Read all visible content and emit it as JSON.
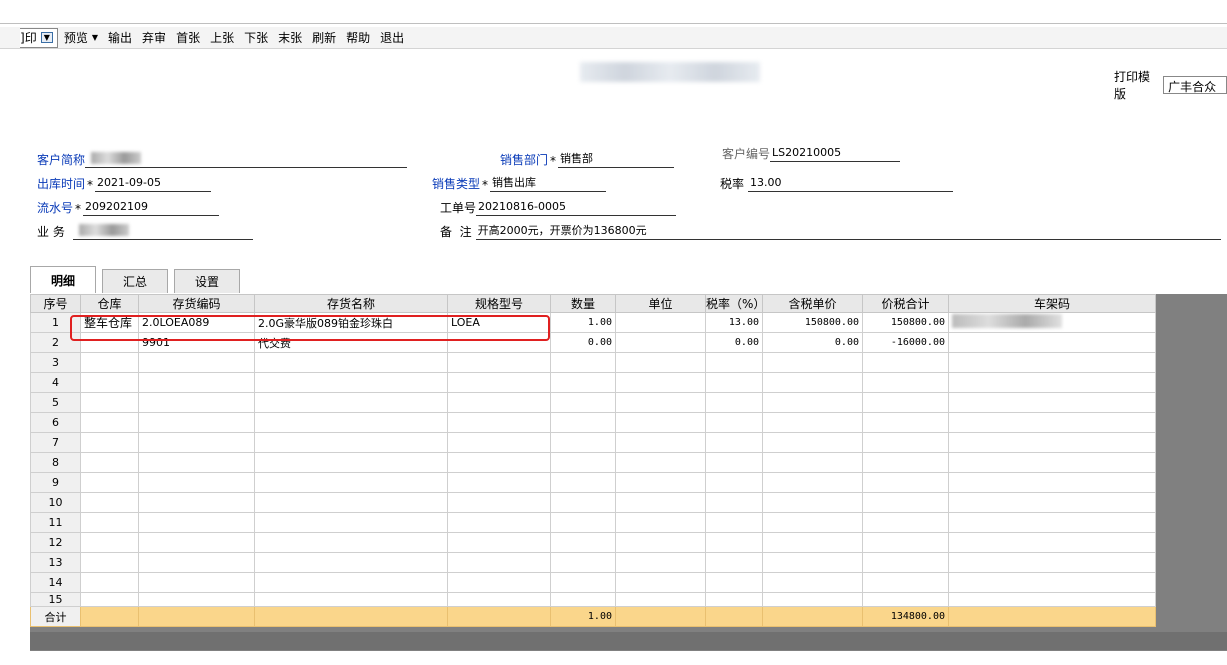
{
  "toolbar": {
    "print": "印",
    "print_prefix": "]",
    "preview": "预览",
    "export": "输出",
    "unapprove": "弃审",
    "first": "首张",
    "prev": "上张",
    "next": "下张",
    "last": "末张",
    "refresh": "刷新",
    "help": "帮助",
    "exit": "退出"
  },
  "print_template": {
    "label": "打印模版",
    "value": "广丰合众"
  },
  "form": {
    "customer_name": {
      "label": "客户简称",
      "value": ""
    },
    "dept": {
      "label": "销售部门",
      "value": "销售部"
    },
    "customer_code": {
      "label": "客户编号",
      "value": "LS20210005"
    },
    "out_date": {
      "label": "出库时间",
      "value": "2021-09-05"
    },
    "sale_type": {
      "label": "销售类型",
      "value": "销售出库"
    },
    "tax_rate": {
      "label": "税率",
      "value": "13.00"
    },
    "serial": {
      "label": "流水号",
      "value": "209202109"
    },
    "work_order": {
      "label": "工单号",
      "value": "20210816-0005"
    },
    "business": {
      "label": "业 务",
      "value": ""
    },
    "remark": {
      "label": "备  注",
      "value": "开高2000元，开票价为136800元"
    }
  },
  "tabs": [
    "明细",
    "汇总",
    "设置"
  ],
  "grid": {
    "headers": [
      "序号",
      "仓库",
      "存货编码",
      "存货名称",
      "规格型号",
      "数量",
      "单位",
      "税率（%）",
      "含税单价",
      "价税合计",
      "车架码"
    ],
    "rows": [
      [
        "1",
        "整车仓库",
        "2.0LOEA089",
        "2.0G豪华版089铂金珍珠白",
        "LOEA",
        "1.00",
        "",
        "13.00",
        "150800.00",
        "150800.00",
        ""
      ],
      [
        "2",
        "",
        "9901",
        "代交费",
        "",
        "0.00",
        "",
        "0.00",
        "0.00",
        "-16000.00",
        ""
      ],
      [
        "3",
        "",
        "",
        "",
        "",
        "",
        "",
        "",
        "",
        "",
        ""
      ],
      [
        "4",
        "",
        "",
        "",
        "",
        "",
        "",
        "",
        "",
        "",
        ""
      ],
      [
        "5",
        "",
        "",
        "",
        "",
        "",
        "",
        "",
        "",
        "",
        ""
      ],
      [
        "6",
        "",
        "",
        "",
        "",
        "",
        "",
        "",
        "",
        "",
        ""
      ],
      [
        "7",
        "",
        "",
        "",
        "",
        "",
        "",
        "",
        "",
        "",
        ""
      ],
      [
        "8",
        "",
        "",
        "",
        "",
        "",
        "",
        "",
        "",
        "",
        ""
      ],
      [
        "9",
        "",
        "",
        "",
        "",
        "",
        "",
        "",
        "",
        "",
        ""
      ],
      [
        "10",
        "",
        "",
        "",
        "",
        "",
        "",
        "",
        "",
        "",
        ""
      ],
      [
        "11",
        "",
        "",
        "",
        "",
        "",
        "",
        "",
        "",
        "",
        ""
      ],
      [
        "12",
        "",
        "",
        "",
        "",
        "",
        "",
        "",
        "",
        "",
        ""
      ],
      [
        "13",
        "",
        "",
        "",
        "",
        "",
        "",
        "",
        "",
        "",
        ""
      ],
      [
        "14",
        "",
        "",
        "",
        "",
        "",
        "",
        "",
        "",
        "",
        ""
      ],
      [
        "15",
        "",
        "",
        "",
        "",
        "",
        "",
        "",
        "",
        "",
        ""
      ]
    ],
    "total": {
      "label": "合计",
      "quantity": "1.00",
      "amount": "134800.00"
    }
  }
}
